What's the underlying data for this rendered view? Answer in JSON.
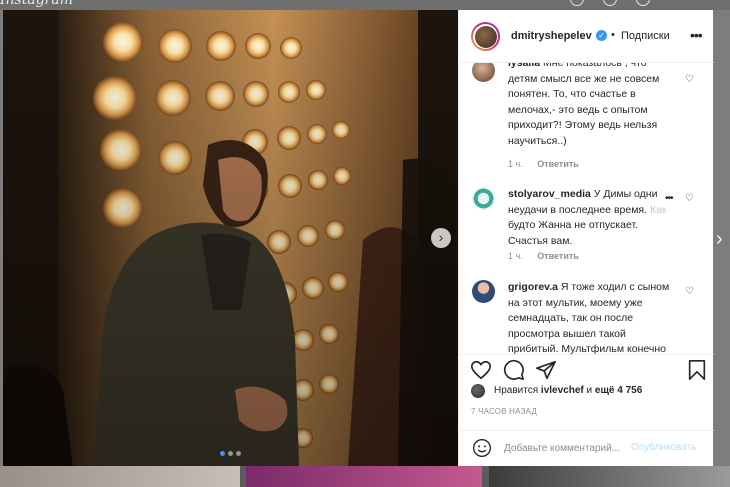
{
  "header": {
    "username": "dmitryshepelev",
    "follow_state": "Подписки",
    "dot": "•"
  },
  "comments": [
    {
      "user": "lysalla",
      "text": "Мне показалось , что детям смысл все же не совсем понятен. То, что счастье в мелочах,- это ведь с опытом приходит?! Этому ведь нельзя научиться..)",
      "time": "1 ч.",
      "reply": "Ответить"
    },
    {
      "user": "stolyarov_media",
      "text_main": "У Димы одни неудачи в последнее время.",
      "text_faded": "Как",
      "text_rest": "будто Жанна не отпускает. Счастья вам.",
      "time": "1 ч.",
      "reply": "Ответить"
    },
    {
      "user": "grigorev.a",
      "text": "Я тоже ходил с сыном на этот мультик, моему уже семнадцать, так он после просмотра вышел такой прибитый. Мультфильм конечно очень неплохой, я"
    }
  ],
  "likes": {
    "prefix": "Нравится",
    "liker": "ivlevchef",
    "conj": "и",
    "others": "ещё 4 756"
  },
  "timestamp": "7 ЧАСОВ НАЗАД",
  "add_comment": {
    "placeholder": "Добавьте комментарий...",
    "post_label": "Опубликовать"
  },
  "carousel": {
    "slides": 3,
    "active_index": 0
  },
  "colors": {
    "accent": "#3897f0",
    "post_disabled": "#b2dffc",
    "text": "#262626",
    "muted": "#8e8e8e"
  },
  "icons": {
    "like": "heart-icon",
    "comment": "comment-icon",
    "share": "send-icon",
    "save": "bookmark-icon",
    "emoji": "smiley-icon",
    "options": "more-horizontal-icon"
  }
}
